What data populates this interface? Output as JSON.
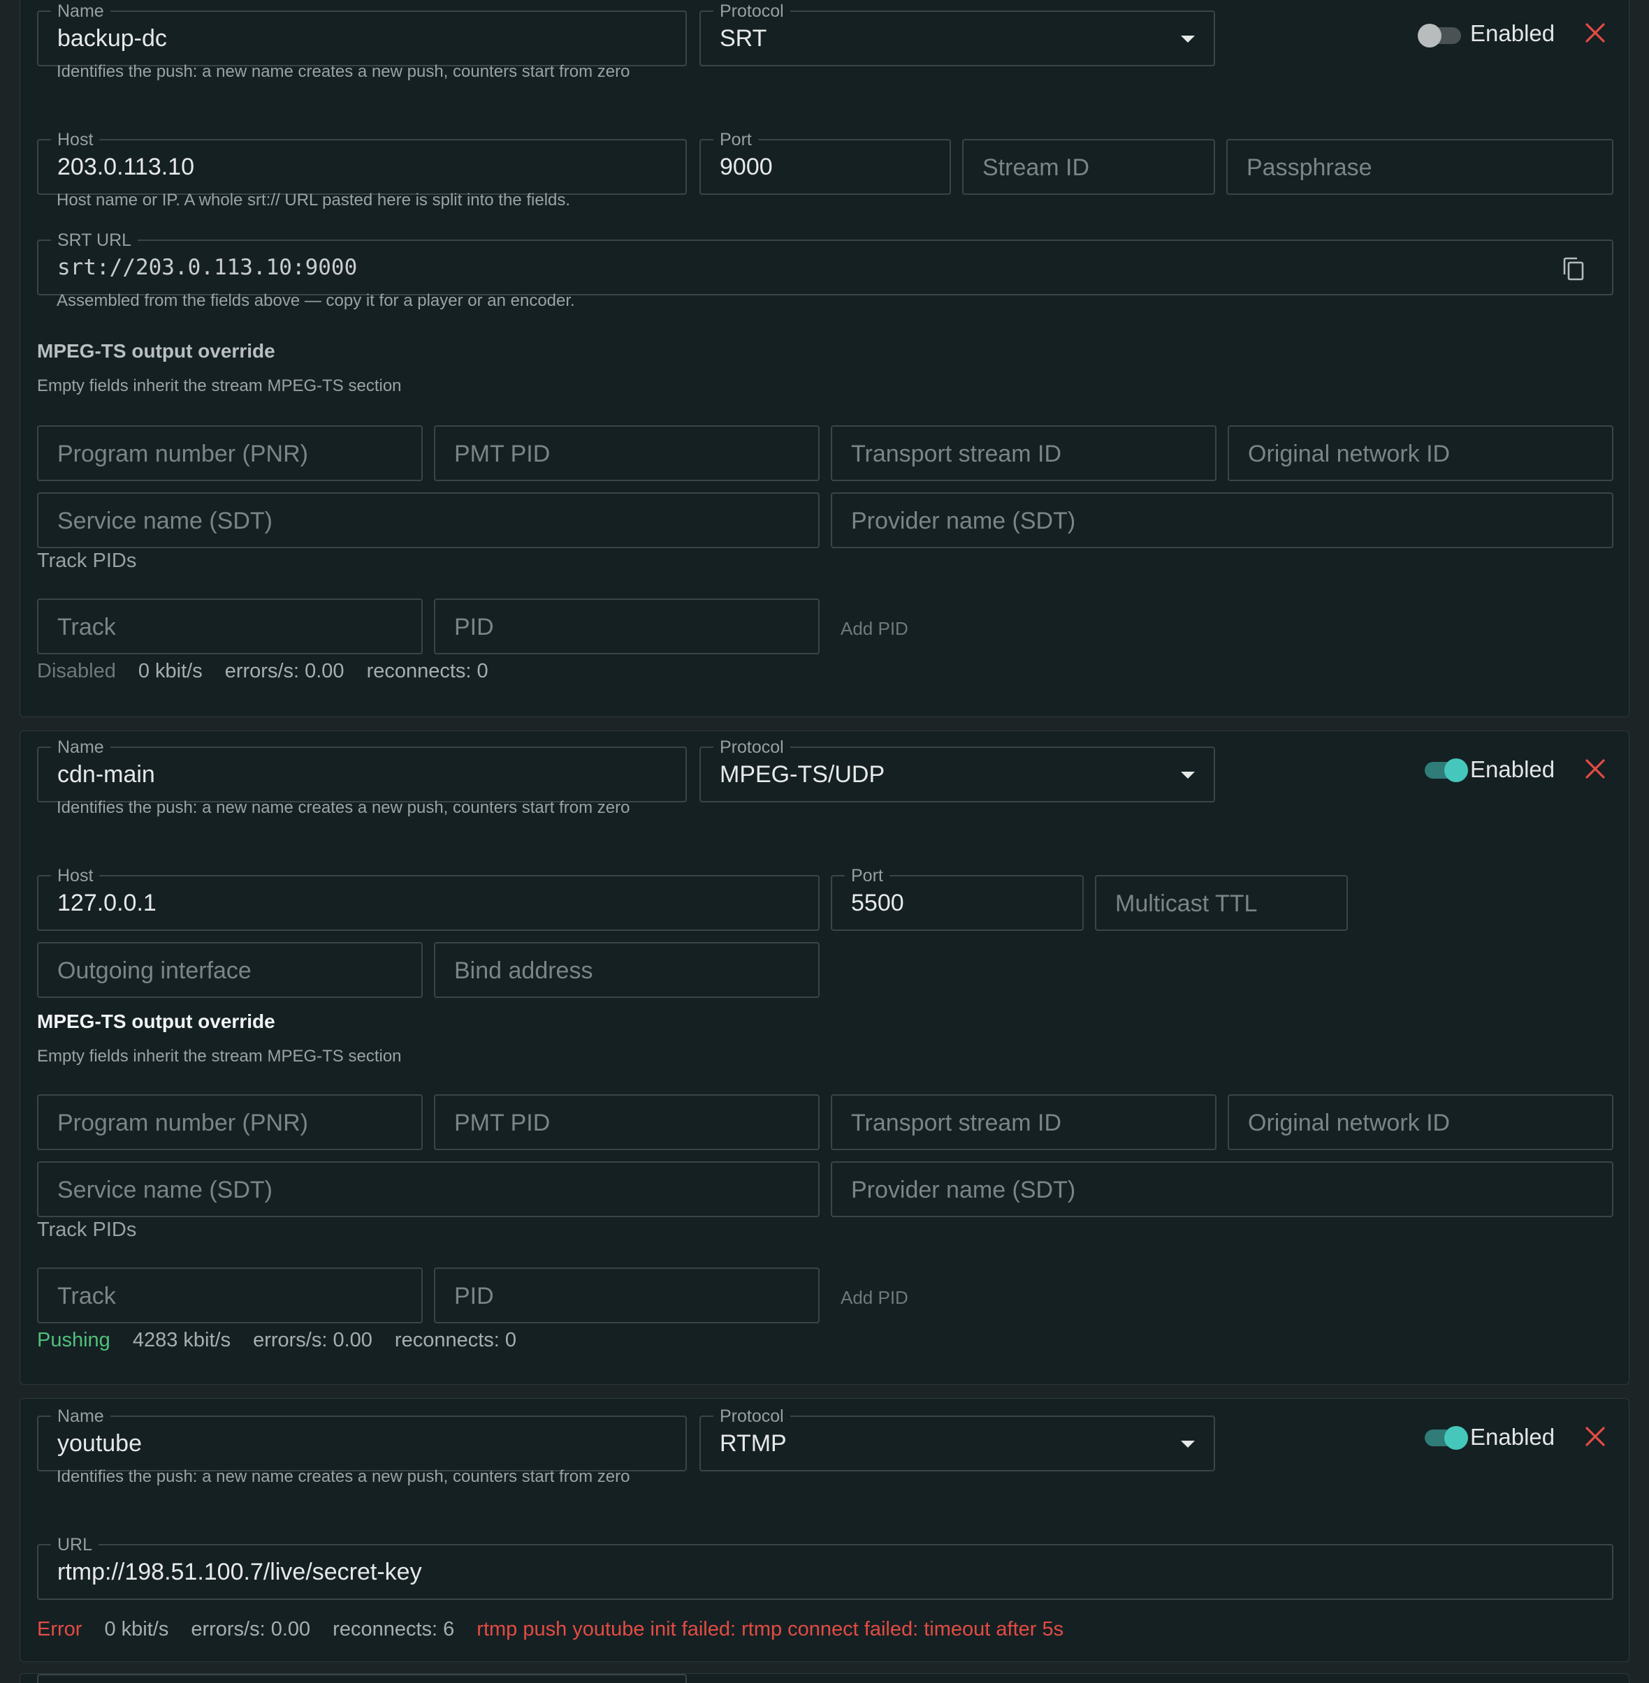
{
  "pushes": [
    {
      "name_label": "Name",
      "name": "backup-dc",
      "protocol_label": "Protocol",
      "protocol": "SRT",
      "enabled_label": "Enabled",
      "enabled": false,
      "name_help": "Identifies the push: a new name creates a new push, counters start from zero",
      "host_label": "Host",
      "host": "203.0.113.10",
      "port_label": "Port",
      "port": "9000",
      "stream_id_placeholder": "Stream ID",
      "passphrase_placeholder": "Passphrase",
      "host_help": "Host name or IP. A whole srt:// URL pasted here is split into the fields.",
      "srt_url_label": "SRT URL",
      "srt_url": "srt://203.0.113.10:9000",
      "srt_url_help": "Assembled from the fields above — copy it for a player or an encoder.",
      "override_title": "MPEG-TS output override",
      "override_sub": "Empty fields inherit the stream MPEG-TS section",
      "pnr_placeholder": "Program number (PNR)",
      "pmt_placeholder": "PMT PID",
      "tsid_placeholder": "Transport stream ID",
      "onid_placeholder": "Original network ID",
      "service_placeholder": "Service name (SDT)",
      "provider_placeholder": "Provider name (SDT)",
      "track_pids_label": "Track PIDs",
      "track_placeholder": "Track",
      "pid_placeholder": "PID",
      "add_pid": "Add PID",
      "status": "Disabled",
      "bitrate": "0 kbit/s",
      "errors": "errors/s: 0.00",
      "reconnects": "reconnects: 0"
    },
    {
      "name_label": "Name",
      "name": "cdn-main",
      "protocol_label": "Protocol",
      "protocol": "MPEG-TS/UDP",
      "enabled_label": "Enabled",
      "enabled": true,
      "name_help": "Identifies the push: a new name creates a new push, counters start from zero",
      "host_label": "Host",
      "host": "127.0.0.1",
      "port_label": "Port",
      "port": "5500",
      "ttl_placeholder": "Multicast TTL",
      "iface_placeholder": "Outgoing interface",
      "bind_placeholder": "Bind address",
      "override_title": "MPEG-TS output override",
      "override_sub": "Empty fields inherit the stream MPEG-TS section",
      "pnr_placeholder": "Program number (PNR)",
      "pmt_placeholder": "PMT PID",
      "tsid_placeholder": "Transport stream ID",
      "onid_placeholder": "Original network ID",
      "service_placeholder": "Service name (SDT)",
      "provider_placeholder": "Provider name (SDT)",
      "track_pids_label": "Track PIDs",
      "track_placeholder": "Track",
      "pid_placeholder": "PID",
      "add_pid": "Add PID",
      "status": "Pushing",
      "bitrate": "4283 kbit/s",
      "errors": "errors/s: 0.00",
      "reconnects": "reconnects: 0"
    },
    {
      "name_label": "Name",
      "name": "youtube",
      "protocol_label": "Protocol",
      "protocol": "RTMP",
      "enabled_label": "Enabled",
      "enabled": true,
      "name_help": "Identifies the push: a new name creates a new push, counters start from zero",
      "url_label": "URL",
      "url": "rtmp://198.51.100.7/live/secret-key",
      "status": "Error",
      "bitrate": "0 kbit/s",
      "errors": "errors/s: 0.00",
      "reconnects": "reconnects: 6",
      "error_message": "rtmp push youtube init failed: rtmp connect failed: timeout after 5s"
    }
  ],
  "colors": {
    "background": "#1c2426",
    "card": "#152023",
    "accent": "#45c8bb",
    "pushing": "#4fc07a",
    "error": "#e34c42",
    "close": "#e34c42"
  },
  "icons": {
    "close": "close-icon",
    "copy": "copy-icon",
    "dropdown": "chevron-down-icon"
  }
}
